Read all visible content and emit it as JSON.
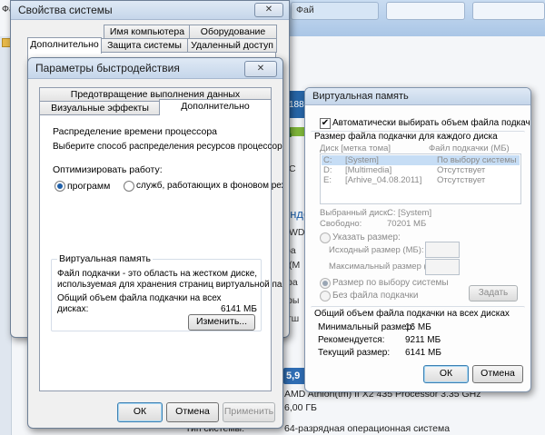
{
  "background": {
    "corner_text": "Фа",
    "bg_tab_fragment": "Фай",
    "blue_number": "188",
    "letter_d": "д",
    "fragment_ende": "енде",
    "fragment_c": "С",
    "fragment_wd": "WD",
    "fragment_pa": "ра",
    "fragment_m": "(M",
    "fragment_ra2": "ра",
    "fragment_ry": "ры",
    "fragment_tsh": "тш",
    "rating": "5,9",
    "cpu_text": "AMD Athlon(tm) II X2 435 Processor 3.35 GHz",
    "ram_value": "6,00 ГБ",
    "os_label": "Тип системы:",
    "os_value": "64-разрядная операционная система"
  },
  "sys_props": {
    "title": "Свойства системы",
    "close": "✕",
    "tabs_row1": [
      "Имя компьютера",
      "Оборудование"
    ],
    "tabs_row2": [
      "Дополнительно",
      "Защита системы",
      "Удаленный доступ"
    ]
  },
  "perf": {
    "title": "Параметры быстродействия",
    "close": "✕",
    "tab_top": "Предотвращение выполнения данных",
    "tab_visual": "Визуальные эффекты",
    "tab_advanced": "Дополнительно",
    "cpu_group": "Распределение времени процессора",
    "cpu_desc": "Выберите способ распределения ресурсов процессора.",
    "optimize_label": "Оптимизировать работу:",
    "radio_programs": "программ",
    "radio_services": "служб, работающих в фоновом режиме",
    "vm_group": "Виртуальная память",
    "vm_desc1": "Файл подкачки - это область на жестком диске,",
    "vm_desc2": "используемая для хранения страниц виртуальной памяти.",
    "total_label1": "Общий объем файла подкачки на всех",
    "total_label2": "дисках:",
    "total_value": "6141 МБ",
    "change_btn": "Изменить...",
    "ok": "ОК",
    "cancel": "Отмена",
    "apply": "Применить"
  },
  "vm": {
    "title": "Виртуальная память",
    "auto_check": "Автоматически выбирать объем файла подкачки",
    "size_group": "Размер файла подкачки для каждого диска",
    "col_disk": "Диск [метка тома]",
    "col_file": "Файл подкачки (МБ)",
    "drives": [
      {
        "letter": "C:",
        "label": "[System]",
        "size": "По выбору системы"
      },
      {
        "letter": "D:",
        "label": "[Multimedia]",
        "size": "Отсутствует"
      },
      {
        "letter": "E:",
        "label": "[Arhive_04.08.2011]",
        "size": "Отсутствует"
      }
    ],
    "selected_label": "Выбранный диск:",
    "selected_value": "C:  [System]",
    "free_label": "Свободно:",
    "free_value": "70201 МБ",
    "radio_custom": "Указать размер:",
    "initial_label": "Исходный размер (МБ):",
    "max_label": "Максимальный размер (МБ):",
    "radio_system": "Размер по выбору системы",
    "radio_none": "Без файла подкачки",
    "set_btn": "Задать",
    "total_group": "Общий объем файла подкачки на всех дисках",
    "min_label": "Минимальный размер:",
    "min_value": "16 МБ",
    "rec_label": "Рекомендуется:",
    "rec_value": "9211 МБ",
    "cur_label": "Текущий размер:",
    "cur_value": "6141 МБ",
    "ok": "ОК",
    "cancel": "Отмена"
  }
}
